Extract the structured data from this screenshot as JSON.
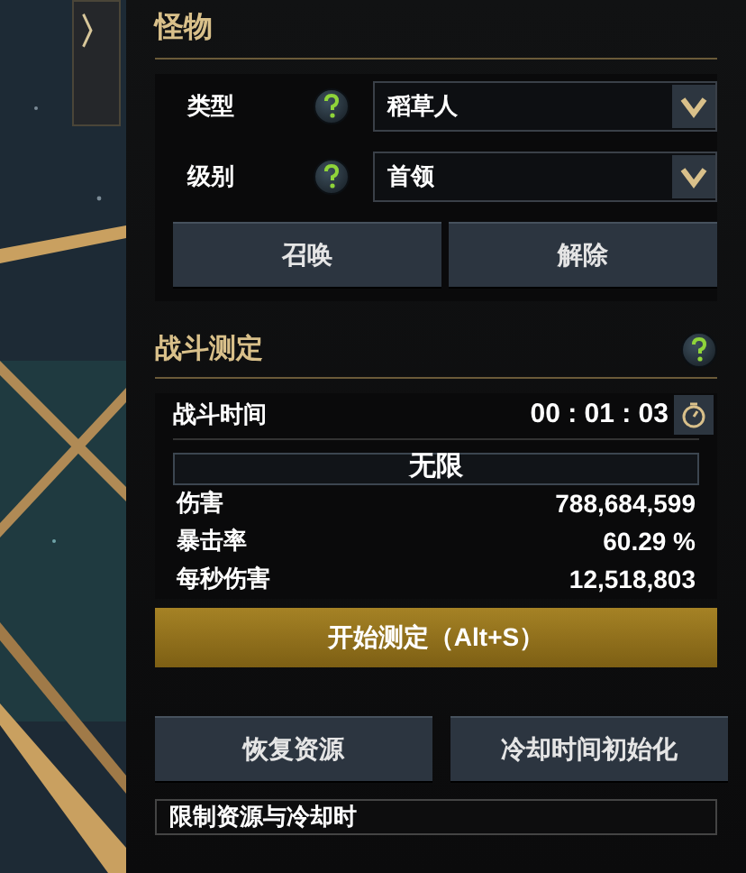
{
  "collapse_tab": {
    "label": "〉"
  },
  "monster": {
    "title": "怪物",
    "fields": [
      {
        "label": "类型",
        "value": "稻草人"
      },
      {
        "label": "级别",
        "value": "首领"
      }
    ],
    "buttons": [
      "召唤",
      "解除"
    ]
  },
  "combat": {
    "title": "战斗测定",
    "time_label": "战斗时间",
    "time": "00 : 01 : 03",
    "mode": "无限",
    "stats": [
      {
        "label": "伤害",
        "value": "788,684,599"
      },
      {
        "label": "暴击率",
        "value": "60.29 %"
      },
      {
        "label": "每秒伤害",
        "value": "12,518,803"
      }
    ],
    "start_button": "开始测定（Alt+S）"
  },
  "buttons": [
    "恢复资源",
    "冷却时间初始化"
  ],
  "limit_option": "限制资源与冷却时"
}
